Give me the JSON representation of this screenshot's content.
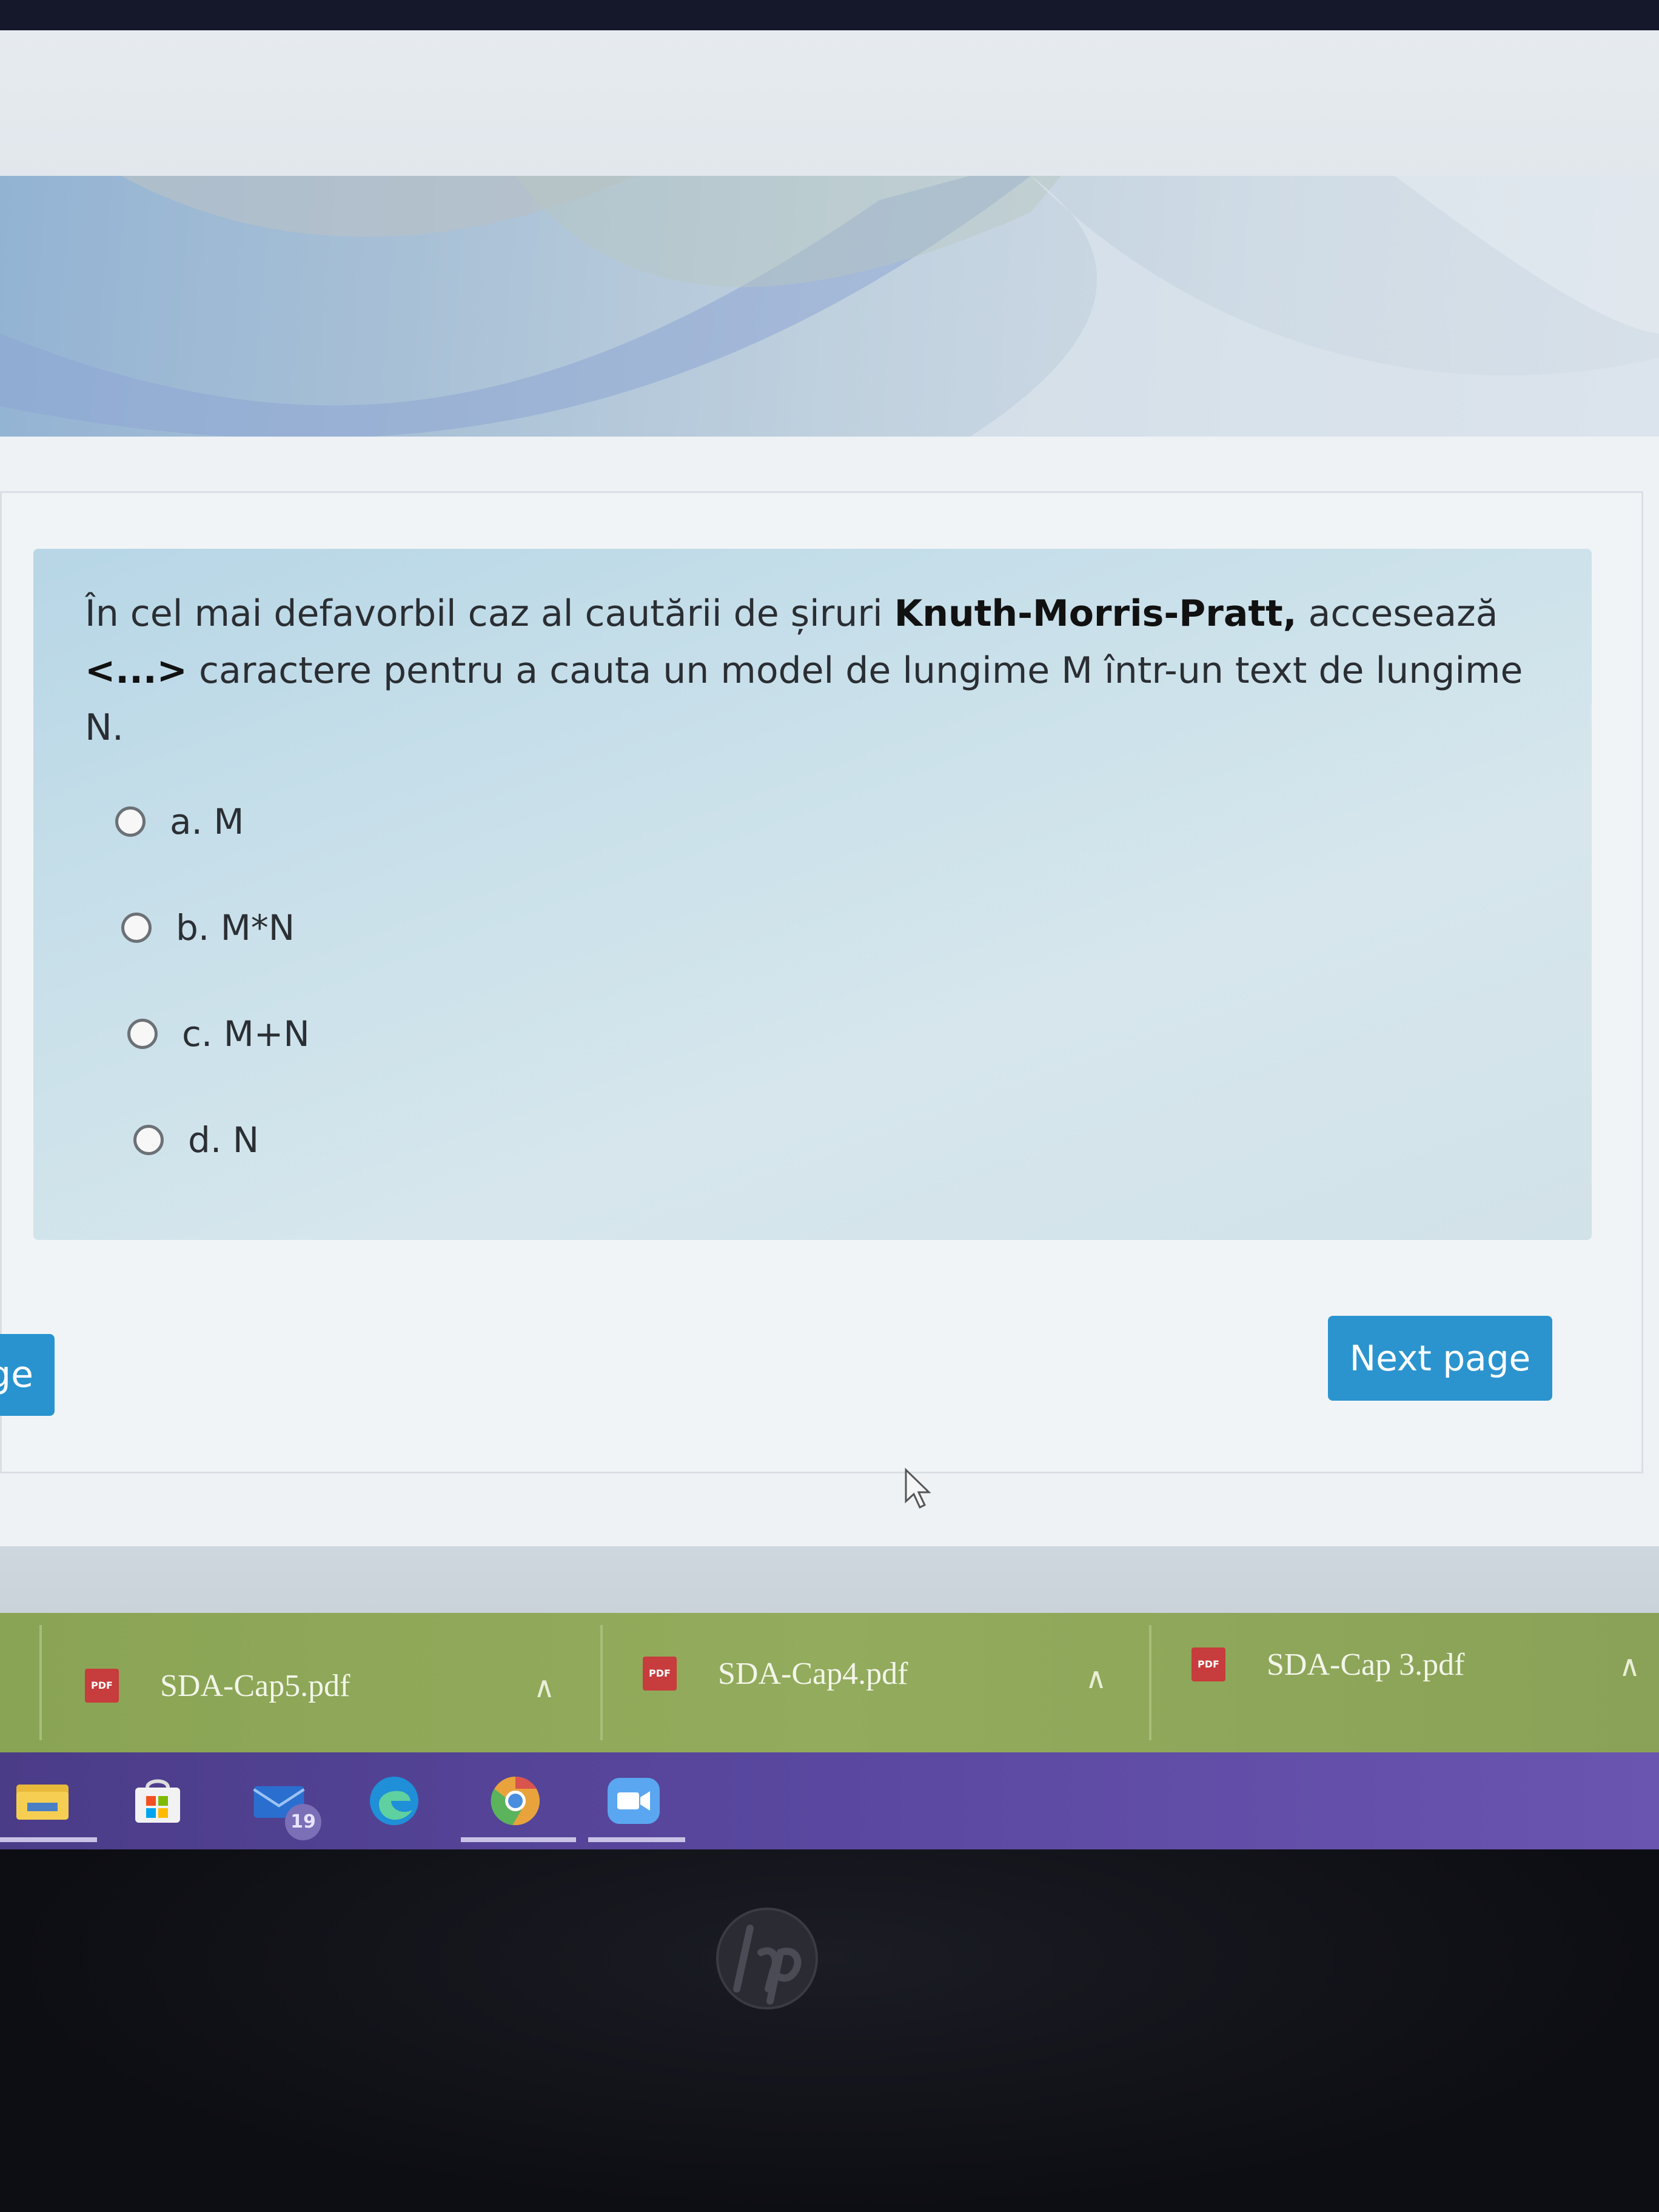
{
  "question": {
    "text_part1": "În cel mai defavorbil caz al cautării de șiruri ",
    "text_bold": "Knuth-Morris-Pratt,",
    "text_part2": " accesează ",
    "text_bold2": "<...>",
    "text_part3": " caractere pentru a cauta un model de lungime M într-un text de lungime N."
  },
  "options": [
    {
      "label": "a. M"
    },
    {
      "label": "b. M*N"
    },
    {
      "label": "c. M+N"
    },
    {
      "label": "d. N"
    }
  ],
  "navigation": {
    "prev_label_fragment": "ge",
    "next_label": "Next page"
  },
  "downloads": [
    {
      "name": "SDA-Cap5.pdf",
      "icon": "pdf-icon"
    },
    {
      "name": "SDA-Cap4.pdf",
      "icon": "pdf-icon"
    },
    {
      "name": "SDA-Cap 3.pdf",
      "icon": "pdf-icon"
    }
  ],
  "taskbar": {
    "apps": [
      "file-explorer-icon",
      "store-icon",
      "mail-icon",
      "edge-icon",
      "chrome-icon",
      "zoom-icon"
    ],
    "mail_badge": "19"
  },
  "colors": {
    "accent": "#2b94cf",
    "question_bg": "#c9e0ea",
    "downloads_bar": "#8fa85a",
    "taskbar": "#5a48a0"
  }
}
